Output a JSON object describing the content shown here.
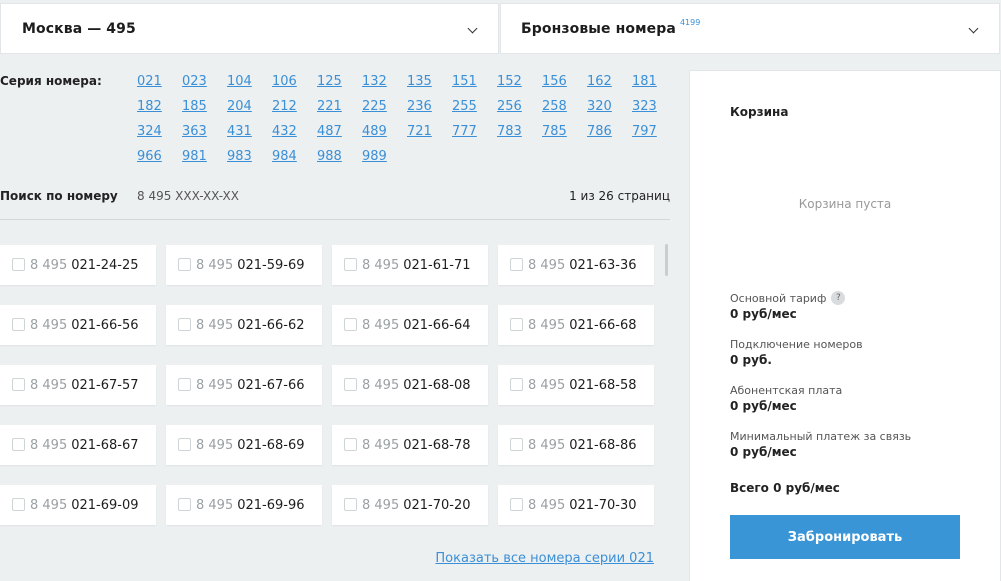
{
  "region_dropdown": {
    "label": "Москва — 495"
  },
  "type_dropdown": {
    "label": "Бронзовые номера",
    "count": "4199"
  },
  "series": {
    "label": "Серия номера:",
    "items": [
      "021",
      "023",
      "104",
      "106",
      "125",
      "132",
      "135",
      "151",
      "152",
      "156",
      "162",
      "181",
      "182",
      "185",
      "204",
      "212",
      "221",
      "225",
      "236",
      "255",
      "256",
      "258",
      "320",
      "323",
      "324",
      "363",
      "431",
      "432",
      "487",
      "489",
      "721",
      "777",
      "783",
      "785",
      "786",
      "797",
      "966",
      "981",
      "983",
      "984",
      "988",
      "989"
    ]
  },
  "search": {
    "label": "Поиск по номеру",
    "placeholder": "8 495 XXX-XX-XX"
  },
  "pagination": {
    "text": "1 из 26 страниц"
  },
  "numbers": {
    "prefix": "8 495",
    "items": [
      "021-24-25",
      "021-59-69",
      "021-61-71",
      "021-63-36",
      "021-66-56",
      "021-66-62",
      "021-66-64",
      "021-66-68",
      "021-67-57",
      "021-67-66",
      "021-68-08",
      "021-68-58",
      "021-68-67",
      "021-68-69",
      "021-68-78",
      "021-68-86",
      "021-69-09",
      "021-69-96",
      "021-70-20",
      "021-70-30"
    ]
  },
  "show_all": "Показать все номера серии 021",
  "cart": {
    "title": "Корзина",
    "empty_text": "Корзина пуста",
    "costs": [
      {
        "label": "Основной тариф",
        "value": "0 руб/мес",
        "help": "?"
      },
      {
        "label": "Подключение номеров",
        "value": "0 руб."
      },
      {
        "label": "Абонентская плата",
        "value": "0 руб/мес"
      },
      {
        "label": "Минимальный платеж за связь",
        "value": "0 руб/мес"
      }
    ],
    "total": "Всего 0 руб/мес",
    "reserve_button": "Забронировать"
  },
  "colors": {
    "accent": "#3a95d6",
    "link": "#3b8fd6",
    "background": "#ecf0f1"
  }
}
